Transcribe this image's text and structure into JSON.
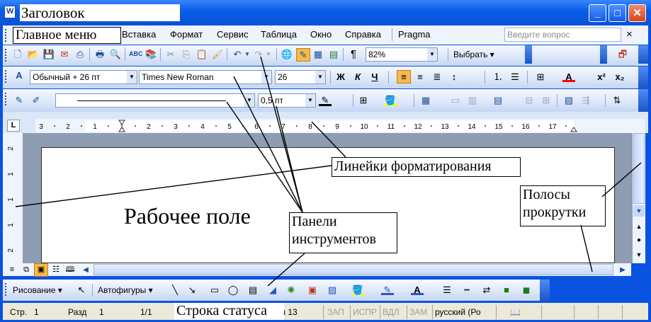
{
  "window": {
    "title": "Заголовок",
    "buttons": {
      "minimize": "_",
      "maximize": "□",
      "close": "✕"
    }
  },
  "menubar": {
    "label": "Главное меню",
    "items": [
      "Вставка",
      "Формат",
      "Сервис",
      "Таблица",
      "Окно",
      "Справка",
      "Pragma"
    ],
    "help_placeholder": "Введите вопрос",
    "close": "×"
  },
  "standard_toolbar": {
    "zoom": "82%",
    "select_label": "Выбрать",
    "pilcrow": "¶"
  },
  "formatting_toolbar": {
    "style": "Обычный + 26 пт",
    "font": "Times New Roman",
    "size": "26",
    "bold": "Ж",
    "italic": "К",
    "underline": "Ч",
    "superscript": "x²",
    "subscript": "x₂"
  },
  "tables_toolbar": {
    "line_weight": "0,5 пт"
  },
  "ruler": {
    "labels": [
      "3",
      "2",
      "1",
      "1",
      "2",
      "3",
      "4",
      "5",
      "6",
      "7",
      "8",
      "9",
      "10",
      "11",
      "12",
      "13",
      "14",
      "15",
      "16",
      "17"
    ],
    "vertical_labels": [
      "2",
      "1",
      "1",
      "1",
      "2"
    ]
  },
  "document": {
    "workspace_label": "Рабочее поле"
  },
  "callouts": {
    "rulers": "Линейки форматирования",
    "toolbars": "Панели инструментов",
    "scrollbars": "Полосы прокрутки",
    "statusbar": "Строка статуса"
  },
  "drawing_toolbar": {
    "draw": "Рисование",
    "autoshapes": "Автофигуры"
  },
  "statusbar": {
    "page": "Стр.",
    "page_num": "1",
    "section": "Разд",
    "section_num": "1",
    "pages": "1/1",
    "column": "л 13",
    "rec": "ЗАП",
    "trk": "ИСПР",
    "ext": "ВДЛ",
    "ovr": "ЗАМ",
    "lang": "русский (Ро"
  },
  "colors": {
    "title_bar": "#0a5ee8",
    "toolbar": "#dbe6f9",
    "font_color_underline": "#ff0000",
    "highlight": "#ffff00",
    "active_align": "#f6b94b"
  }
}
